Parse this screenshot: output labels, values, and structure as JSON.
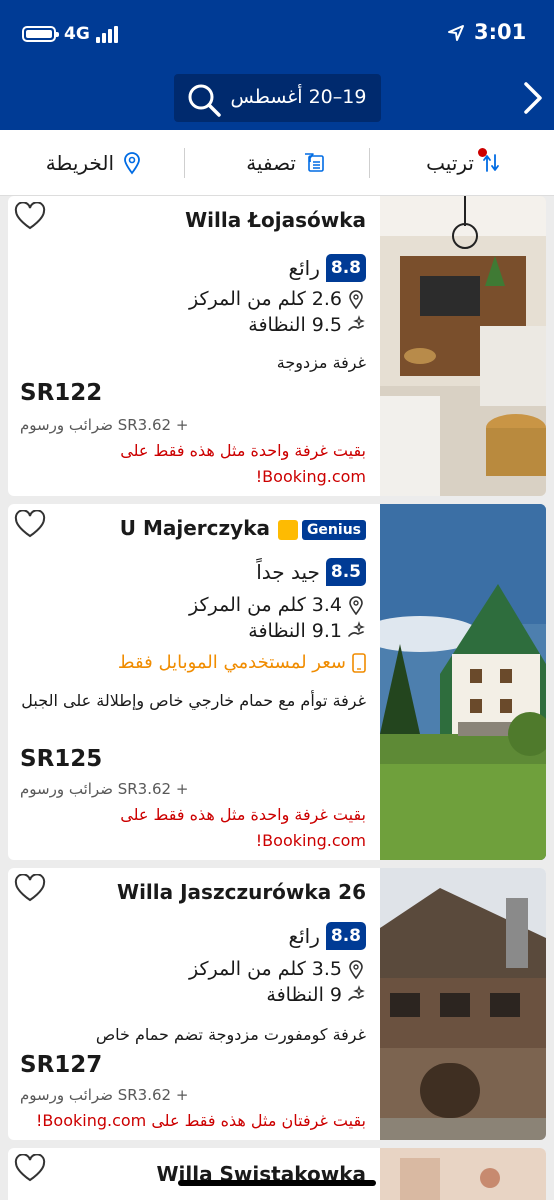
{
  "status_bar": {
    "network": "4G",
    "time": "3:01"
  },
  "header": {
    "dates": "19–20 أغسطس"
  },
  "toolbar": {
    "sort": "ترتيب",
    "filter": "تصفية",
    "map": "الخريطة"
  },
  "colors": {
    "brand": "#003b95",
    "score_bg": "#003b95",
    "alert": "#cc0000",
    "mobile_deal": "#f08c00",
    "genius_thumb": "#febb02"
  },
  "listings": [
    {
      "name": "Willa Łojasówka",
      "score": "8.8",
      "score_label": "رائع",
      "distance": "2.6 كلم من المركز",
      "cleanliness": "9.5 النظافة",
      "room": "غرفة مزدوجة",
      "price": "SR122",
      "taxes": "+ SR3.62 ضرائب ورسوم",
      "availability": "بقيت غرفة واحدة مثل هذه فقط على Booking.com!"
    },
    {
      "name": "U Majerczyka",
      "genius": "Genius",
      "score": "8.5",
      "score_label": "جيد جداً",
      "distance": "3.4 كلم من المركز",
      "cleanliness": "9.1 النظافة",
      "mobile_rate": "سعر لمستخدمي الموبايل فقط",
      "room": "غرفة توأم مع حمام خارجي خاص وإطلالة على الجبل",
      "price": "SR125",
      "taxes": "+ SR3.62 ضرائب ورسوم",
      "availability": "بقيت غرفة واحدة مثل هذه فقط على Booking.com!"
    },
    {
      "name": "Willa Jaszczurówka 26",
      "score": "8.8",
      "score_label": "رائع",
      "distance": "3.5 كلم من المركز",
      "cleanliness": "9 النظافة",
      "room": "غرفة كومفورت مزدوجة تضم حمام خاص",
      "price": "SR127",
      "taxes": "+ SR3.62 ضرائب ورسوم",
      "availability": "بقيت غرفتان مثل هذه فقط على Booking.com!"
    },
    {
      "name": "Willa Swistakowka"
    }
  ]
}
